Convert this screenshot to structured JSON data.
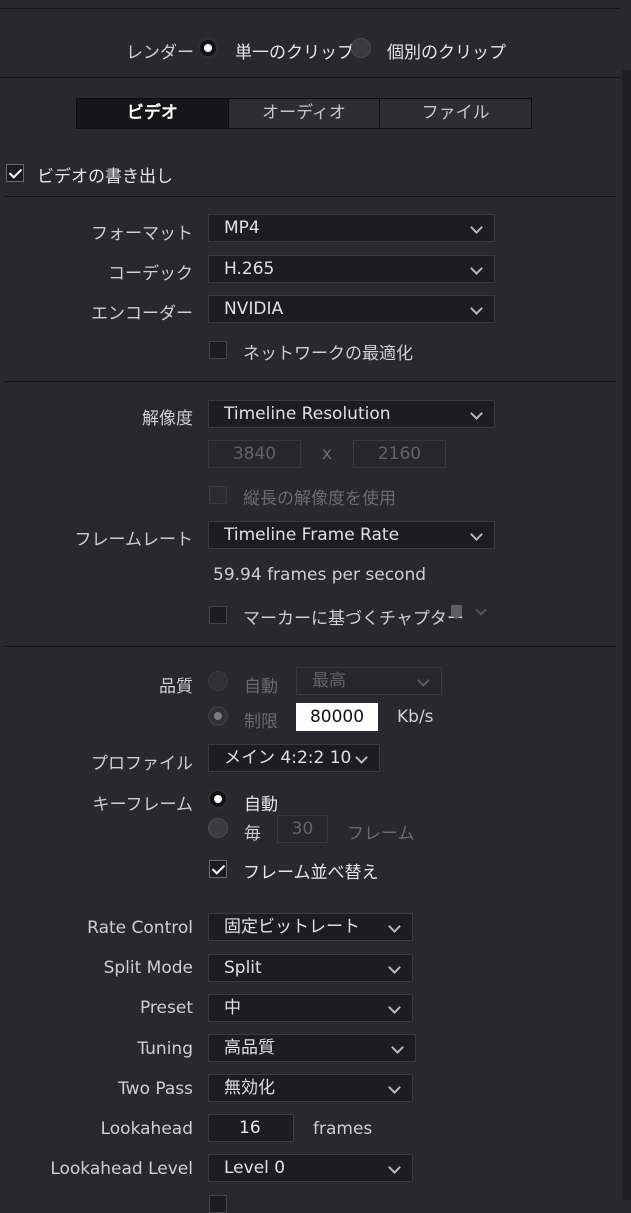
{
  "render": {
    "label": "レンダー",
    "single_clip": "単一のクリップ",
    "individual_clips": "個別のクリップ"
  },
  "tabs": [
    {
      "label": "ビデオ",
      "active": true
    },
    {
      "label": "オーディオ",
      "active": false
    },
    {
      "label": "ファイル",
      "active": false
    }
  ],
  "video_export": {
    "label": "ビデオの書き出し",
    "checked": true
  },
  "format": {
    "label": "フォーマット",
    "value": "MP4"
  },
  "codec": {
    "label": "コーデック",
    "value": "H.265"
  },
  "encoder": {
    "label": "エンコーダー",
    "value": "NVIDIA"
  },
  "network_optimize": {
    "label": "ネットワークの最適化",
    "checked": false
  },
  "resolution": {
    "label": "解像度",
    "value": "Timeline Resolution",
    "width": "3840",
    "x_label": "x",
    "height": "2160",
    "vertical_label": "縦長の解像度を使用"
  },
  "frame_rate": {
    "label": "フレームレート",
    "value": "Timeline Frame Rate",
    "fps_text": "59.94 frames per second"
  },
  "chapters": {
    "label": "マーカーに基づくチャプター",
    "checked": false
  },
  "quality": {
    "label": "品質",
    "auto_label": "自動",
    "auto_value": "最高",
    "limit_label": "制限",
    "limit_value": "80000",
    "unit": "Kb/s"
  },
  "profile": {
    "label": "プロファイル",
    "value": "メイン 4:2:2 10"
  },
  "keyframe": {
    "label": "キーフレーム",
    "auto_label": "自動",
    "every_label": "毎",
    "every_value": "30",
    "unit": "フレーム"
  },
  "frame_reorder": {
    "label": "フレーム並べ替え",
    "checked": true
  },
  "rate_control": {
    "label": "Rate Control",
    "value": "固定ビットレート"
  },
  "split_mode": {
    "label": "Split Mode",
    "value": "Split"
  },
  "preset": {
    "label": "Preset",
    "value": "中"
  },
  "tuning": {
    "label": "Tuning",
    "value": "高品質"
  },
  "two_pass": {
    "label": "Two Pass",
    "value": "無効化"
  },
  "lookahead": {
    "label": "Lookahead",
    "value": "16",
    "unit": "frames"
  },
  "lookahead_level": {
    "label": "Lookahead Level",
    "value": "Level 0"
  }
}
